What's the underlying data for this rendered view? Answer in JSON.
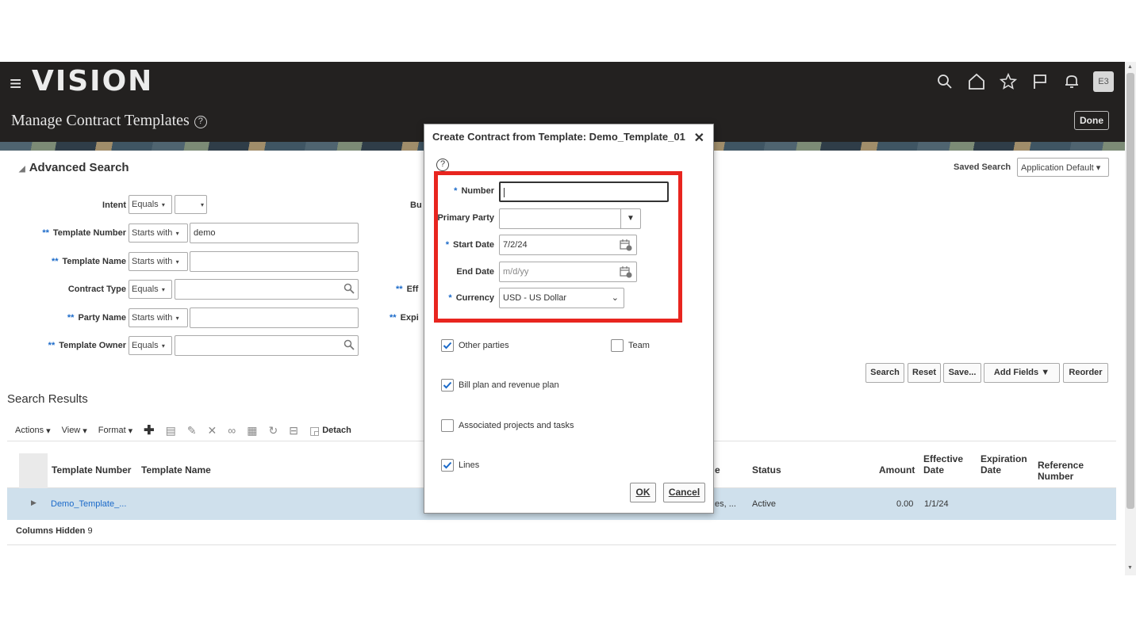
{
  "header": {
    "logo": "VISION",
    "page_title": "Manage Contract Templates",
    "help_glyph": "?",
    "avatar_initials": "E3",
    "done_label": "Done",
    "icons": [
      "search-icon",
      "home-icon",
      "star-icon",
      "flag-icon",
      "bell-icon"
    ]
  },
  "search": {
    "title": "Advanced Search",
    "saved_search_label": "Saved Search",
    "saved_search_value": "Application Default",
    "fields": {
      "intent": {
        "label": "Intent",
        "operator": "Equals",
        "value": ""
      },
      "template_number": {
        "req": "**",
        "label": "Template Number",
        "operator": "Starts with",
        "value": "demo"
      },
      "template_name": {
        "req": "**",
        "label": "Template Name",
        "operator": "Starts with",
        "value": ""
      },
      "contract_type": {
        "label": "Contract Type",
        "operator": "Equals",
        "value": ""
      },
      "party_name": {
        "req": "**",
        "label": "Party Name",
        "operator": "Starts with",
        "value": ""
      },
      "template_owner": {
        "req": "**",
        "label": "Template Owner",
        "operator": "Equals",
        "value": ""
      }
    },
    "partial_labels": {
      "bu": "Bu",
      "eff": "Eff",
      "expi": "Expi",
      "req": "**"
    },
    "buttons": {
      "search": "Search",
      "reset": "Reset",
      "save": "Save...",
      "add_fields": "Add Fields",
      "reorder": "Reorder"
    }
  },
  "results": {
    "title": "Search Results",
    "toolbar": {
      "actions": "Actions",
      "view": "View",
      "format": "Format",
      "detach": "Detach"
    },
    "columns": {
      "template_number": "Template Number",
      "template_name": "Template Name",
      "e": "e",
      "status": "Status",
      "amount": "Amount",
      "effective_date": "Effective Date",
      "expiration_date": "Expiration Date",
      "reference_number": "Reference Number"
    },
    "row": {
      "template_number": "Demo_Template_...",
      "partial": "es, ...",
      "status": "Active",
      "amount": "0.00",
      "effective_date": "1/1/24"
    },
    "columns_hidden_label": "Columns Hidden",
    "columns_hidden_count": "9"
  },
  "dialog": {
    "title": "Create Contract from Template: Demo_Template_01",
    "close": "✕",
    "help": "?",
    "required_mark": "*",
    "fields": {
      "number": {
        "label": "Number",
        "value": ""
      },
      "primary_party": {
        "label": "Primary Party",
        "value": ""
      },
      "start_date": {
        "label": "Start Date",
        "value": "7/2/24"
      },
      "end_date": {
        "label": "End Date",
        "placeholder": "m/d/yy",
        "value": ""
      },
      "currency": {
        "label": "Currency",
        "value": "USD - US Dollar"
      }
    },
    "checkboxes": {
      "other_parties": {
        "label": "Other parties",
        "checked": true
      },
      "team": {
        "label": "Team",
        "checked": false
      },
      "bill_plan": {
        "label": "Bill plan and revenue plan",
        "checked": true
      },
      "associated_projects": {
        "label": "Associated projects and tasks",
        "checked": false
      },
      "lines": {
        "label": "Lines",
        "checked": true
      }
    },
    "ok_label": "OK",
    "cancel_label": "Cancel"
  },
  "colors": {
    "header_bg": "#232120",
    "highlight": "#e8251f",
    "check": "#1b6ac9",
    "row_selected": "#cfe0ec"
  }
}
